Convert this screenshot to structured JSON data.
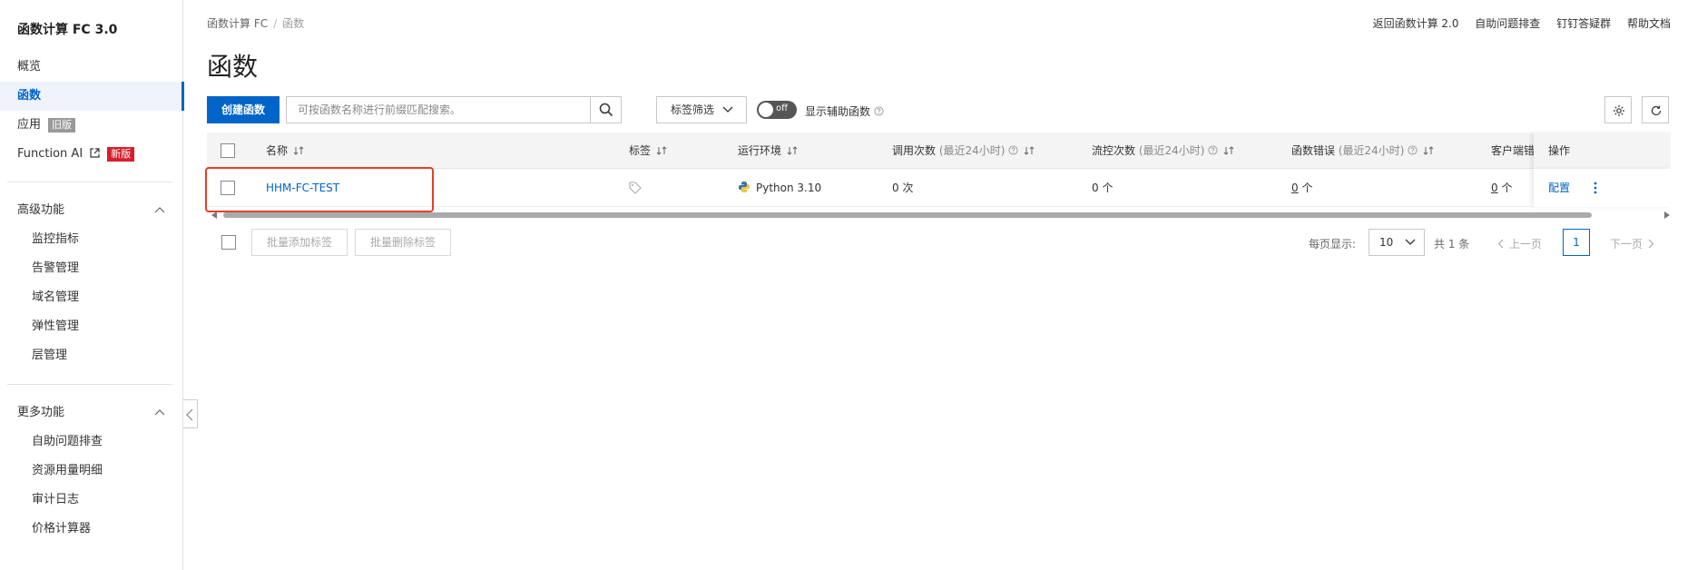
{
  "sidebar": {
    "title": "函数计算 FC 3.0",
    "items": [
      {
        "label": "概览"
      },
      {
        "label": "函数"
      },
      {
        "label": "应用",
        "badge": "旧版"
      },
      {
        "label": "Function AI",
        "badge": "新版"
      }
    ],
    "groups": [
      {
        "label": "高级功能",
        "items": [
          "监控指标",
          "告警管理",
          "域名管理",
          "弹性管理",
          "层管理"
        ]
      },
      {
        "label": "更多功能",
        "items": [
          "自助问题排查",
          "资源用量明细",
          "审计日志",
          "价格计算器"
        ]
      }
    ]
  },
  "header": {
    "breadcrumb": [
      "函数计算 FC",
      "函数"
    ],
    "links": [
      "返回函数计算 2.0",
      "自助问题排查",
      "钉钉答疑群",
      "帮助文档"
    ],
    "title": "函数"
  },
  "toolbar": {
    "create_label": "创建函数",
    "search_placeholder": "可按函数名称进行前缀匹配搜索。",
    "filter_label": "标签筛选",
    "toggle_state": "off",
    "toggle_text": "显示辅助函数"
  },
  "table": {
    "columns": [
      {
        "label": "名称"
      },
      {
        "label": "标签"
      },
      {
        "label": "运行环境"
      },
      {
        "label": "调用次数",
        "hint": "(最近24小时)"
      },
      {
        "label": "流控次数",
        "hint": "(最近24小时)"
      },
      {
        "label": "函数错误",
        "hint": "(最近24小时)"
      },
      {
        "label": "客户端错"
      },
      {
        "label": "操作"
      }
    ],
    "rows": [
      {
        "name": "HHM-FC-TEST",
        "runtime": "Python 3.10",
        "invocations": "0 次",
        "throttles": "0 个",
        "errors_num": "0",
        "errors_unit": " 个",
        "client_num": "0",
        "client_unit": " 个",
        "op_config": "配置"
      }
    ]
  },
  "footer": {
    "batch_add_tag": "批量添加标签",
    "batch_delete_tag": "批量删除标签",
    "page_size_label": "每页显示:",
    "page_size": "10",
    "total": "共 1 条",
    "prev": "上一页",
    "page": "1",
    "next": "下一页"
  },
  "colors": {
    "primary": "#0064c8",
    "highlight_border": "#e0412b",
    "new_badge": "#d4202b"
  }
}
